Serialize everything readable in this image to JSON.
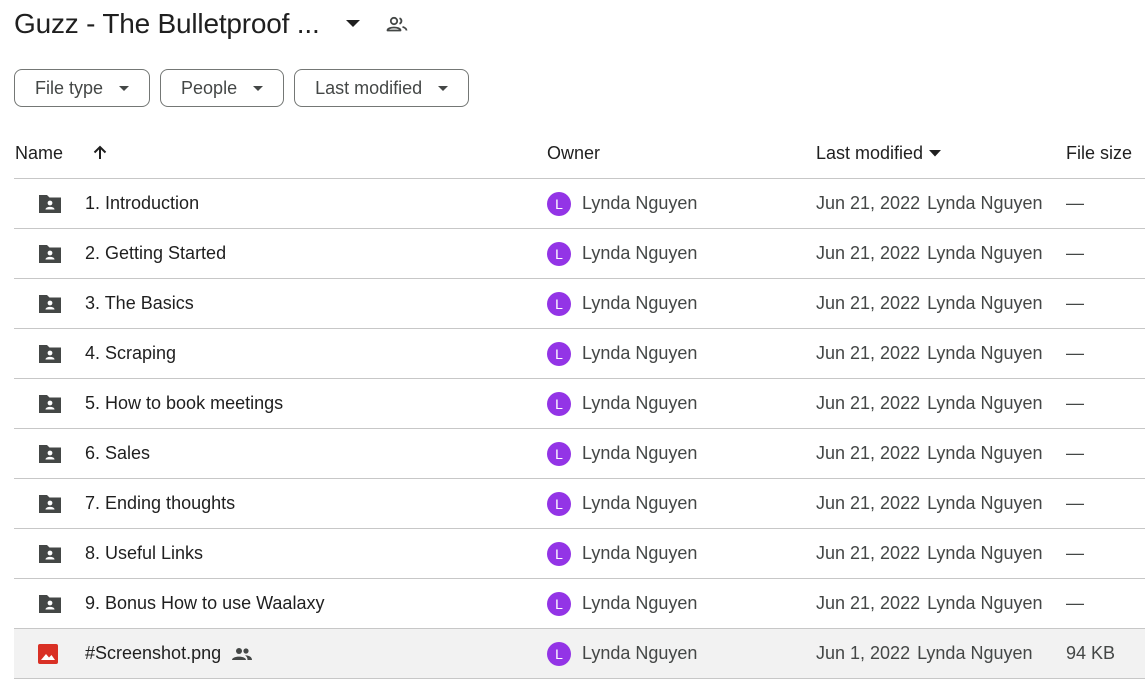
{
  "header": {
    "title": "Guzz - The Bulletproof ...",
    "dropdown_icon": "arrow-drop-down-icon",
    "people_icon": "shared-people-icon"
  },
  "filters": [
    {
      "label": "File type"
    },
    {
      "label": "People"
    },
    {
      "label": "Last modified"
    }
  ],
  "columns": {
    "name": "Name",
    "owner": "Owner",
    "last_modified": "Last modified",
    "file_size": "File size"
  },
  "colors": {
    "avatar": "#9334e6",
    "folder_icon": "#444746",
    "image_icon": "#d93025"
  },
  "rows": [
    {
      "type": "folder",
      "name": "1. Introduction",
      "owner_initial": "L",
      "owner": "Lynda Nguyen",
      "modified_date": "Jun 21, 2022",
      "modified_by": "Lynda Nguyen",
      "size": "—"
    },
    {
      "type": "folder",
      "name": "2. Getting Started",
      "owner_initial": "L",
      "owner": "Lynda Nguyen",
      "modified_date": "Jun 21, 2022",
      "modified_by": "Lynda Nguyen",
      "size": "—"
    },
    {
      "type": "folder",
      "name": "3. The Basics",
      "owner_initial": "L",
      "owner": "Lynda Nguyen",
      "modified_date": "Jun 21, 2022",
      "modified_by": "Lynda Nguyen",
      "size": "—"
    },
    {
      "type": "folder",
      "name": "4. Scraping",
      "owner_initial": "L",
      "owner": "Lynda Nguyen",
      "modified_date": "Jun 21, 2022",
      "modified_by": "Lynda Nguyen",
      "size": "—"
    },
    {
      "type": "folder",
      "name": "5. How to book meetings",
      "owner_initial": "L",
      "owner": "Lynda Nguyen",
      "modified_date": "Jun 21, 2022",
      "modified_by": "Lynda Nguyen",
      "size": "—"
    },
    {
      "type": "folder",
      "name": "6. Sales",
      "owner_initial": "L",
      "owner": "Lynda Nguyen",
      "modified_date": "Jun 21, 2022",
      "modified_by": "Lynda Nguyen",
      "size": "—"
    },
    {
      "type": "folder",
      "name": "7. Ending thoughts",
      "owner_initial": "L",
      "owner": "Lynda Nguyen",
      "modified_date": "Jun 21, 2022",
      "modified_by": "Lynda Nguyen",
      "size": "—"
    },
    {
      "type": "folder",
      "name": "8. Useful Links",
      "owner_initial": "L",
      "owner": "Lynda Nguyen",
      "modified_date": "Jun 21, 2022",
      "modified_by": "Lynda Nguyen",
      "size": "—"
    },
    {
      "type": "folder",
      "name": "9. Bonus How to use Waalaxy",
      "owner_initial": "L",
      "owner": "Lynda Nguyen",
      "modified_date": "Jun 21, 2022",
      "modified_by": "Lynda Nguyen",
      "size": "—"
    },
    {
      "type": "image",
      "name": "#Screenshot.png",
      "shared": true,
      "owner_initial": "L",
      "owner": "Lynda Nguyen",
      "modified_date": "Jun 1, 2022",
      "modified_by": "Lynda Nguyen",
      "size": "94 KB"
    }
  ]
}
